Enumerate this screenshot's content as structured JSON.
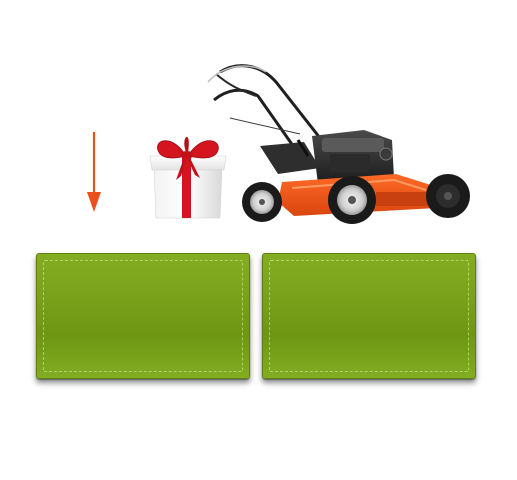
{
  "illustrations": {
    "arrow_icon": "down-arrow-icon",
    "gift_icon": "gift-box-icon",
    "mower_icon": "lawn-mower-image"
  },
  "panels": [
    {
      "label": ""
    },
    {
      "label": ""
    }
  ],
  "colors": {
    "arrow": "#e8501c",
    "ribbon": "#d4141e",
    "panel_green": "#7aa31a",
    "mower_orange": "#ef5a1c"
  }
}
